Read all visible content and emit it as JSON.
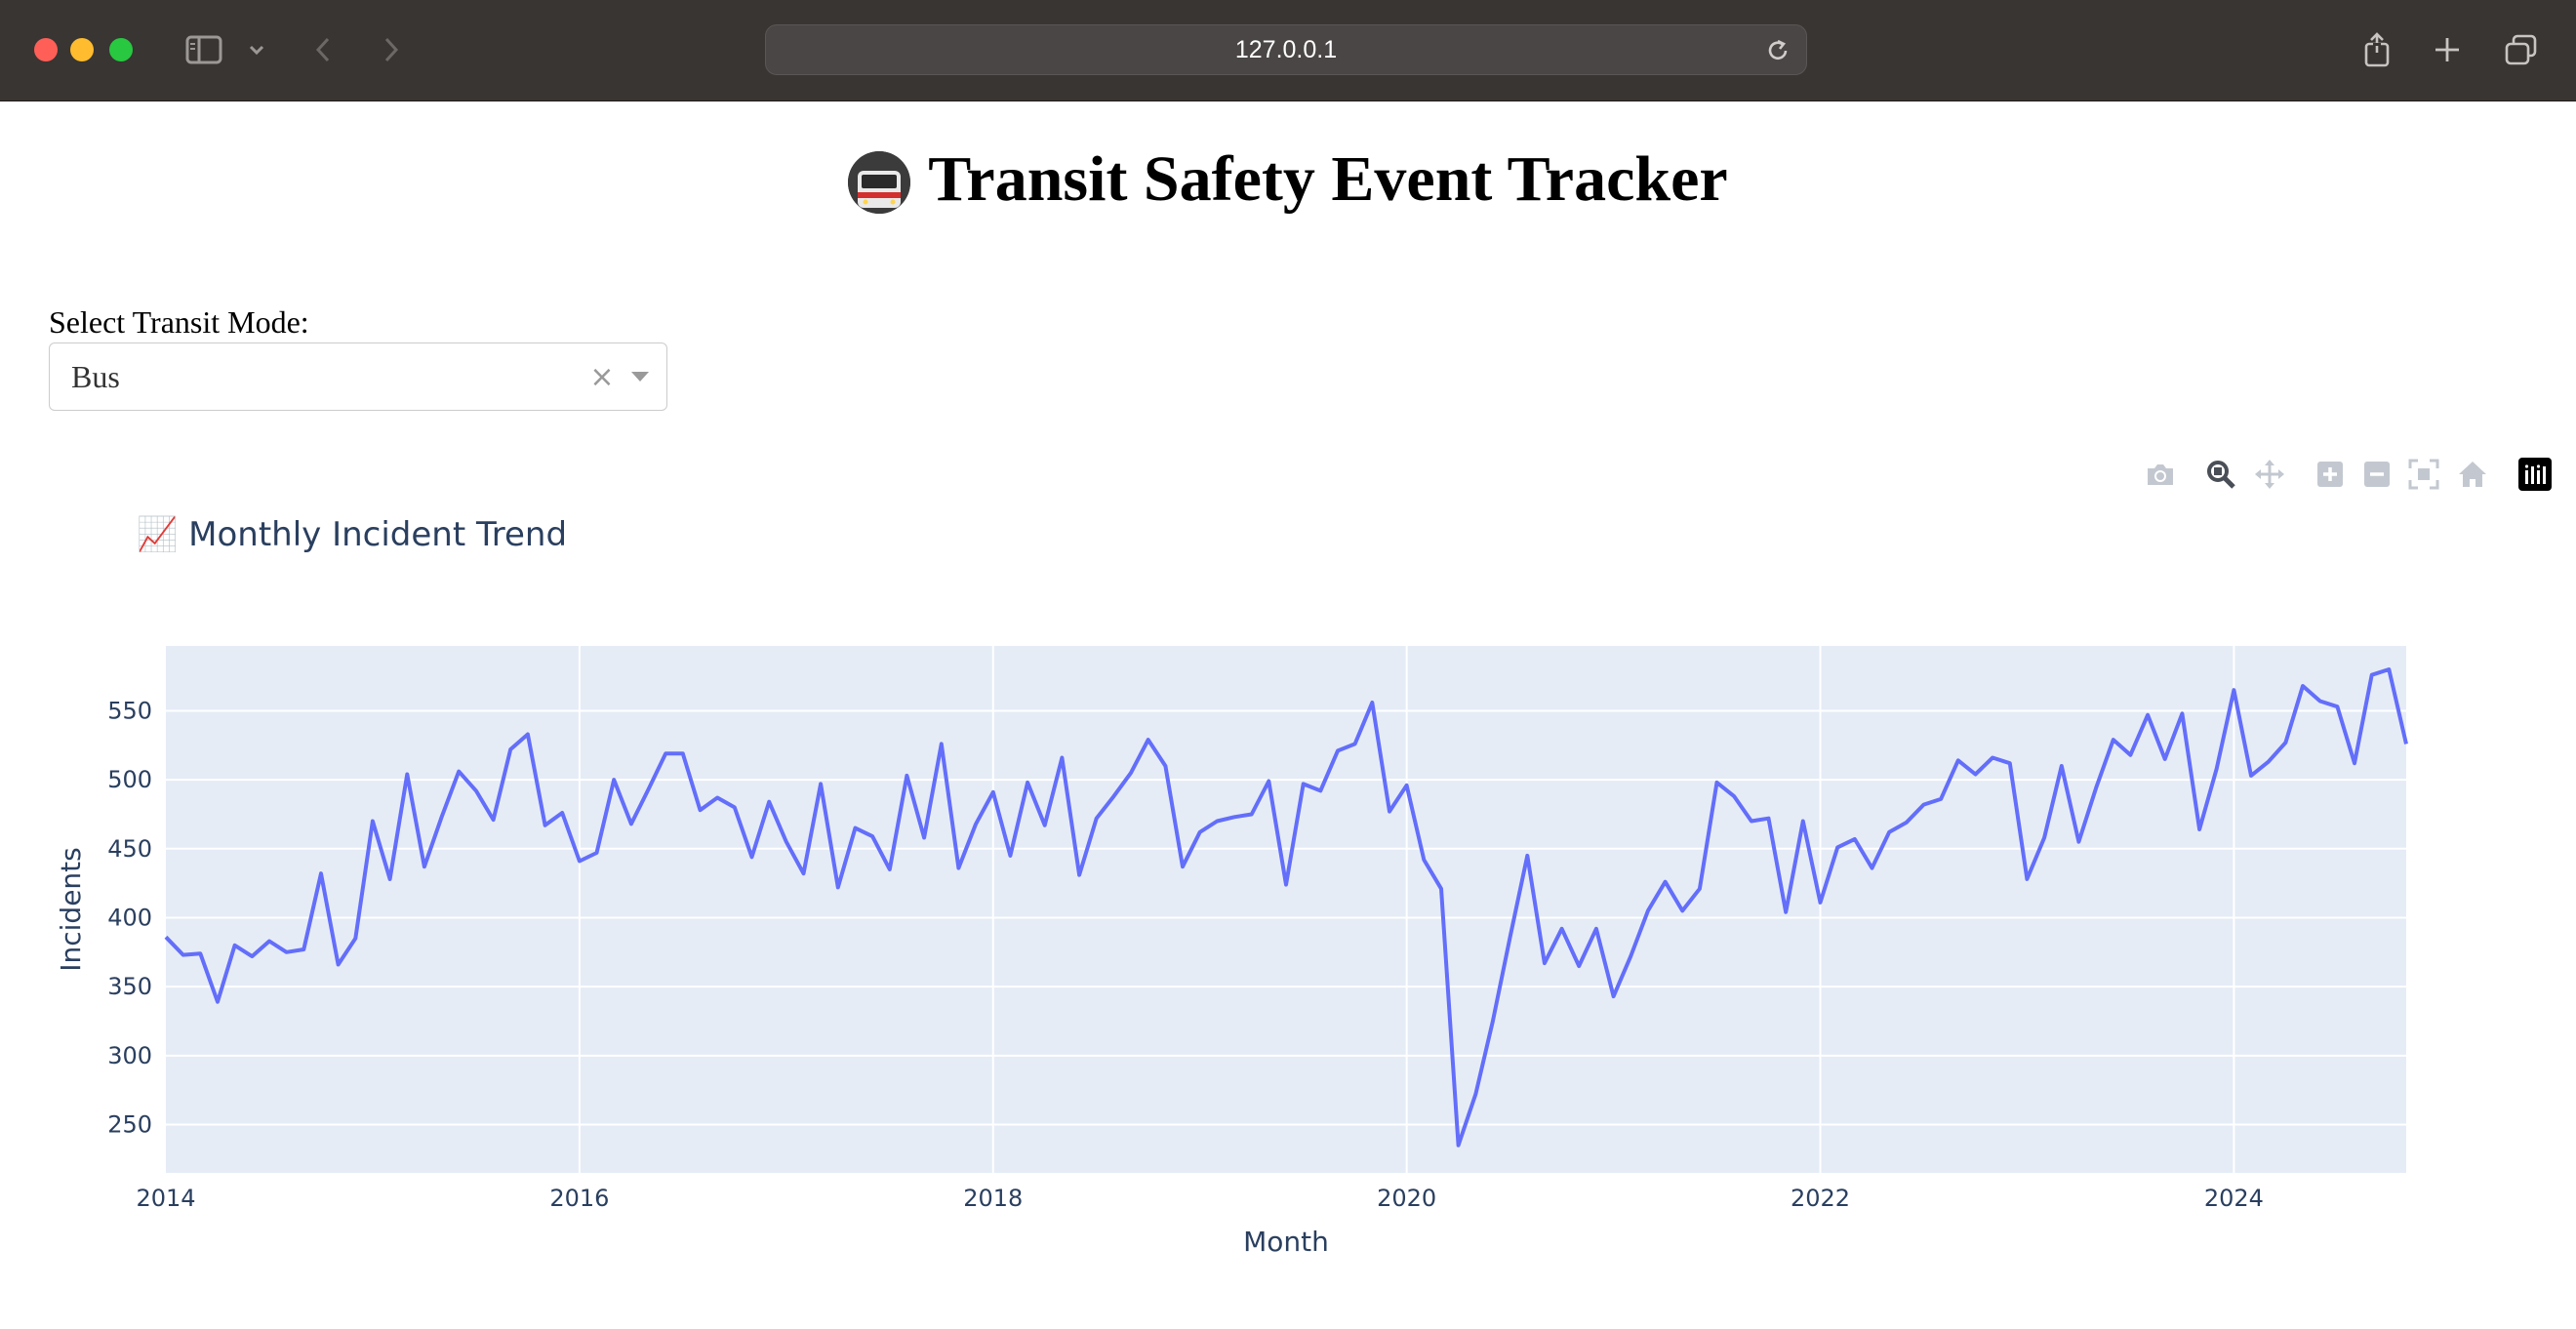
{
  "browser": {
    "url": "127.0.0.1"
  },
  "page": {
    "title": "Transit Safety Event Tracker",
    "mode_label": "Select Transit Mode:",
    "selected_mode": "Bus",
    "clear_symbol": "×"
  },
  "modebar": {
    "buttons": [
      "camera-icon",
      "zoom-icon",
      "pan-icon",
      "zoom-in-icon",
      "zoom-out-icon",
      "autoscale-icon",
      "reset-axes-icon",
      "plotly-logo-icon"
    ]
  },
  "chart_data": {
    "type": "line",
    "title": "📈 Monthly Incident Trend",
    "xlabel": "Month",
    "ylabel": "Incidents",
    "x_start": "2014-01",
    "x_ticks": [
      "2014",
      "2016",
      "2018",
      "2020",
      "2022",
      "2024"
    ],
    "y_ticks": [
      250,
      300,
      350,
      400,
      450,
      500,
      550
    ],
    "ylim": [
      215,
      597
    ],
    "grid": true,
    "colors": {
      "line": "#636efa",
      "plot_bg": "#e5ecf6",
      "text": "#2a3f5f"
    },
    "series": [
      {
        "values": [
          386,
          373,
          374,
          339,
          380,
          372,
          383,
          375,
          377,
          432,
          366,
          385,
          470,
          428,
          504,
          437,
          473,
          506,
          492,
          471,
          522,
          533,
          467,
          476,
          441,
          447,
          500,
          468,
          493,
          519,
          519,
          478,
          487,
          480,
          444,
          484,
          455,
          432,
          497,
          422,
          465,
          459,
          435,
          503,
          458,
          526,
          436,
          468,
          491,
          445,
          498,
          467,
          516,
          431,
          472,
          488,
          505,
          529,
          510,
          437,
          462,
          470,
          473,
          475,
          499,
          424,
          497,
          492,
          521,
          526,
          556,
          477,
          496,
          442,
          421,
          235,
          272,
          325,
          386,
          445,
          367,
          392,
          365,
          392,
          343,
          372,
          405,
          426,
          405,
          421,
          498,
          488,
          470,
          472,
          404,
          470,
          411,
          451,
          457,
          436,
          462,
          469,
          482,
          486,
          514,
          504,
          516,
          512,
          428,
          458,
          510,
          455,
          494,
          529,
          518,
          547,
          515,
          548,
          464,
          508,
          565,
          503,
          513,
          527,
          568,
          557,
          553,
          512,
          576,
          580,
          526
        ]
      }
    ]
  }
}
